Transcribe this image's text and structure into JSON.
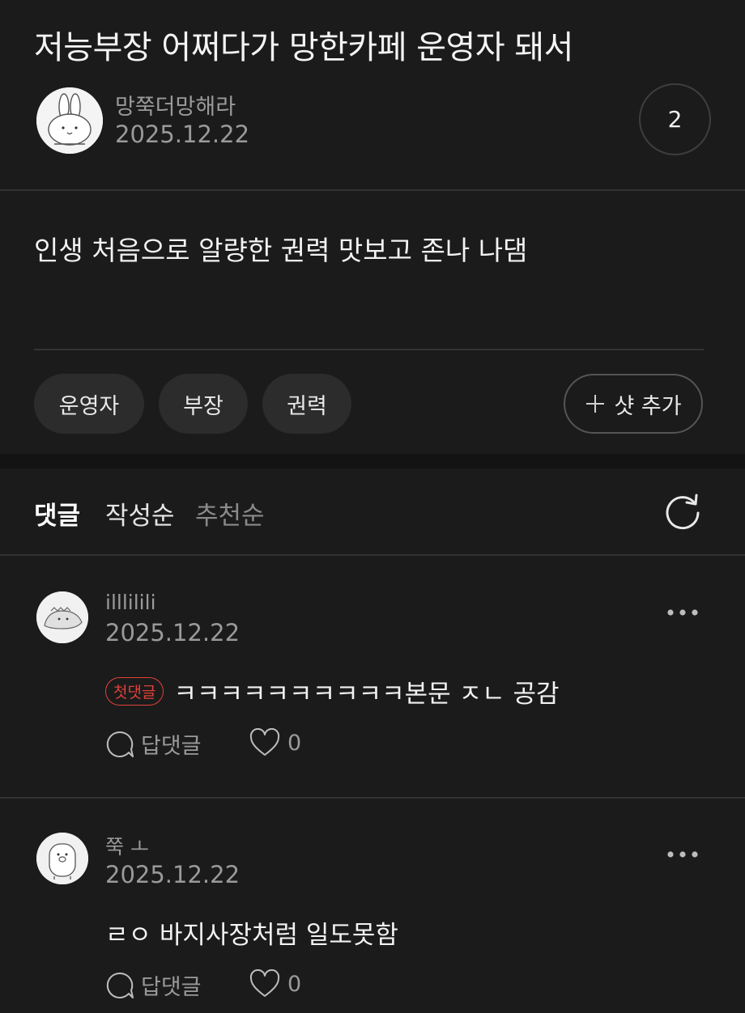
{
  "post": {
    "title": "저능부장 어쩌다가 망한카페 운영자 돼서",
    "author": "망쭉더망해라",
    "date": "2025.12.22",
    "count": "2",
    "body": "인생 처음으로 알량한 권력 맛보고 존나 나댐",
    "tags": [
      "운영자",
      "부장",
      "권력"
    ],
    "add_tag_label": "샷 추가"
  },
  "comments_header": {
    "title": "댓글",
    "sort_written": "작성순",
    "sort_recommended": "추천순"
  },
  "comments": [
    {
      "name": "illlilili",
      "date": "2025.12.22",
      "badge": "첫댓글",
      "text": "ㅋㅋㅋㅋㅋㅋㅋㅋㅋㅋ본문 ㅈㄴ 공감",
      "reply_label": "답댓글",
      "likes": "0"
    },
    {
      "name": "쭉 ㅗ",
      "date": "2025.12.22",
      "text": "ㄹㅇ 바지사장처럼 일도못함",
      "reply_label": "답댓글",
      "likes": "0"
    }
  ]
}
